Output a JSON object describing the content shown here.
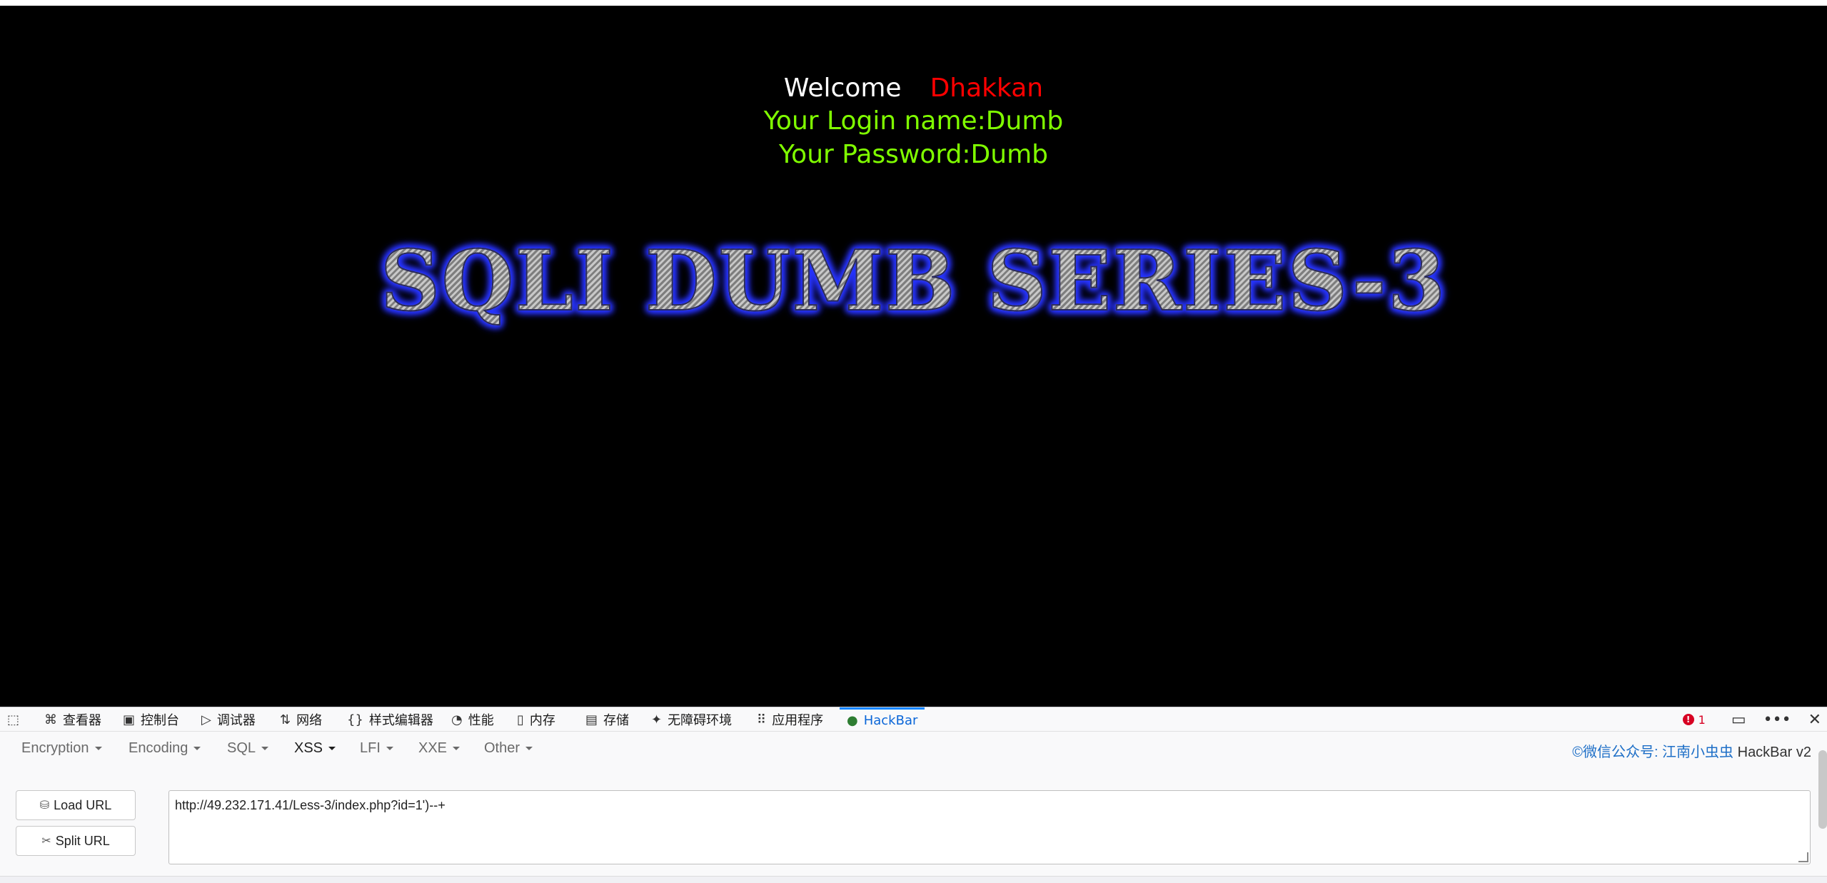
{
  "page": {
    "welcome_label": "Welcome",
    "welcome_name": "Dhakkan",
    "login_line": "Your Login name:Dumb",
    "password_line": "Your Password:Dumb",
    "banner": "SQLI DUMB SERIES-3"
  },
  "devtools": {
    "tabs": [
      {
        "label": "查看器",
        "icon": "inspector-icon"
      },
      {
        "label": "控制台",
        "icon": "console-icon"
      },
      {
        "label": "调试器",
        "icon": "debugger-icon"
      },
      {
        "label": "网络",
        "icon": "network-icon"
      },
      {
        "label": "样式编辑器",
        "icon": "style-editor-icon"
      },
      {
        "label": "性能",
        "icon": "performance-icon"
      },
      {
        "label": "内存",
        "icon": "memory-icon"
      },
      {
        "label": "存储",
        "icon": "storage-icon"
      },
      {
        "label": "无障碍环境",
        "icon": "accessibility-icon"
      },
      {
        "label": "应用程序",
        "icon": "application-icon"
      },
      {
        "label": "HackBar",
        "icon": "hackbar-icon",
        "active": true
      }
    ],
    "error_count": "1"
  },
  "hackbar": {
    "menu": {
      "encryption": "Encryption",
      "encoding": "Encoding",
      "sql": "SQL",
      "xss": "XSS",
      "lfi": "LFI",
      "xxe": "XXE",
      "other": "Other"
    },
    "credit_link": "©微信公众号: 江南小虫虫",
    "credit_suffix": " HackBar v2",
    "load_url": "Load URL",
    "split_url": "Split URL",
    "url_value": "http://49.232.171.41/Less-3/index.php?id=1')--+"
  }
}
